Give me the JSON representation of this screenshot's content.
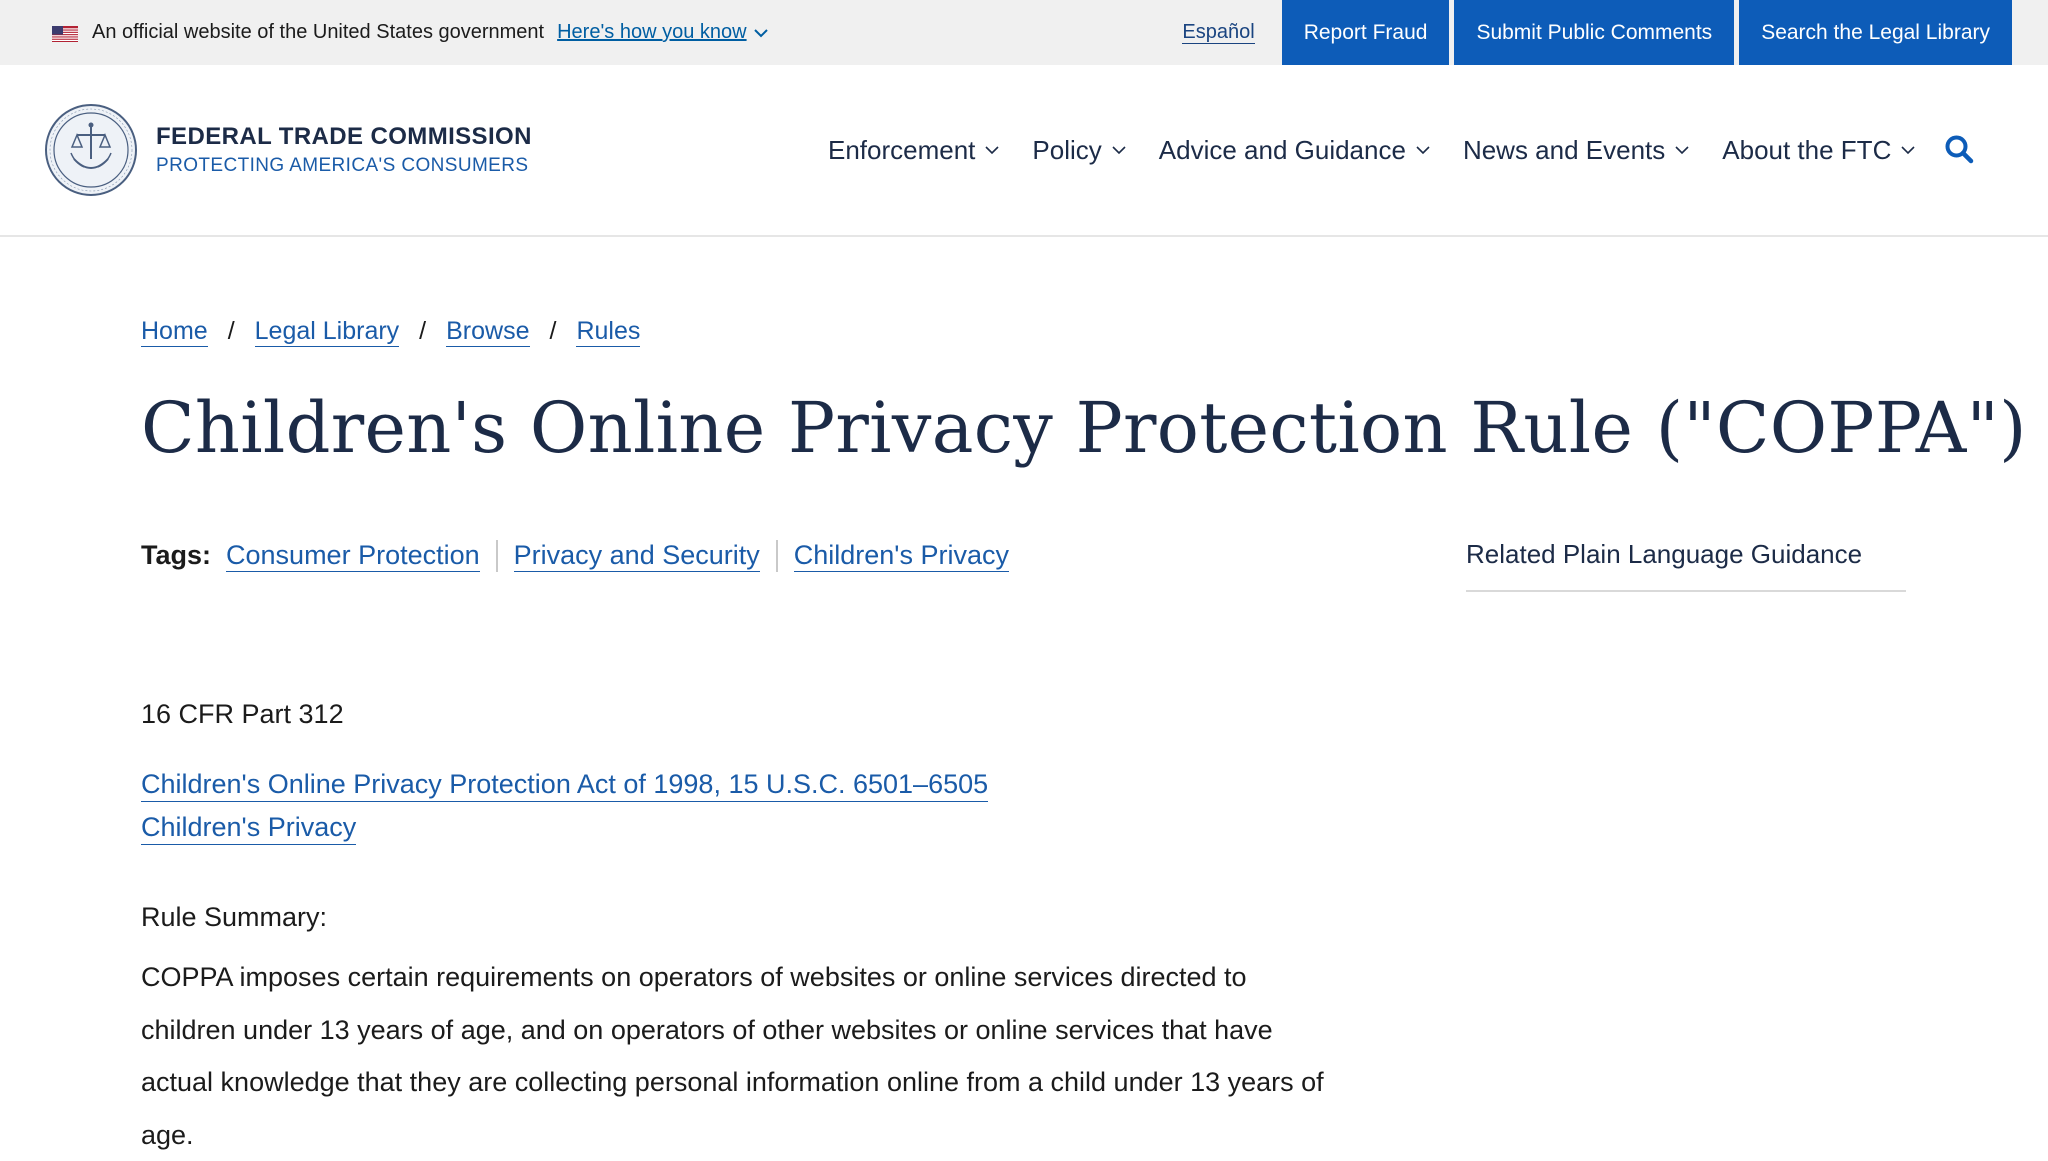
{
  "gov_banner": {
    "official_text": "An official website of the United States government",
    "how_you_know": "Here's how you know",
    "espanol": "Español",
    "utility_buttons": [
      "Report Fraud",
      "Submit Public Comments",
      "Search the Legal Library"
    ]
  },
  "header": {
    "brand_title": "FEDERAL TRADE COMMISSION",
    "brand_subtitle": "PROTECTING AMERICA'S CONSUMERS",
    "nav": [
      "Enforcement",
      "Policy",
      "Advice and Guidance",
      "News and Events",
      "About the FTC"
    ]
  },
  "breadcrumb": [
    "Home",
    "Legal Library",
    "Browse",
    "Rules"
  ],
  "page_title": "Children's Online Privacy Protection Rule (\"COPPA\")",
  "tags": {
    "label": "Tags:",
    "items": [
      "Consumer Protection",
      "Privacy and Security",
      "Children's Privacy"
    ]
  },
  "cfr": "16 CFR Part 312",
  "links": [
    "Children's Online Privacy Protection Act of 1998, 15 U.S.C. 6501–6505",
    "Children's Privacy"
  ],
  "summary": {
    "label": "Rule Summary:",
    "body": "COPPA imposes certain requirements on operators of websites or online services directed to children under 13 years of age, and on operators of other websites or online services that have actual knowledge that they are collecting personal information online from a child under 13 years of age."
  },
  "sidebar": {
    "title": "Related Plain Language Guidance"
  },
  "colors": {
    "utility_button_bg": "#0d5cb8",
    "navy": "#1c2b47",
    "link": "#1a5ba8"
  },
  "icons": [
    "us-flag-icon",
    "chevron-down-icon",
    "ftc-seal-icon",
    "search-icon"
  ]
}
